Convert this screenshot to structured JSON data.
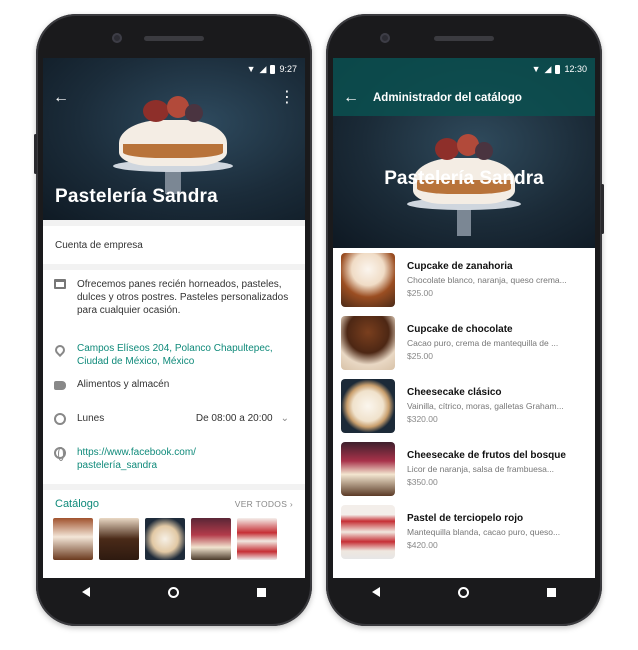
{
  "left_phone": {
    "status": {
      "time": "9:27"
    },
    "business_name": "Pastelería Sandra",
    "account_type": "Cuenta de empresa",
    "description": "Ofrecemos panes recién horneados, pasteles, dulces y otros postres. Pasteles personalizados para cualquier ocasión.",
    "address": "Campos Elíseos 204, Polanco Chapultepec, Ciudad de México, México",
    "category": "Alimentos y almacén",
    "hours": {
      "day": "Lunes",
      "time": "De 08:00 a 20:00"
    },
    "website": "https://www.facebook.com/ pastelería_sandra",
    "catalog": {
      "title": "Catálogo",
      "see_all": "VER TODOS"
    }
  },
  "right_phone": {
    "status": {
      "time": "12:30"
    },
    "appbar_title": "Administrador del catálogo",
    "business_name": "Pastelería Sandra",
    "products": [
      {
        "name": "Cupcake de zanahoria",
        "desc": "Chocolate blanco, naranja, queso crema...",
        "price": "$25.00"
      },
      {
        "name": "Cupcake de chocolate",
        "desc": "Cacao puro, crema de mantequilla de ...",
        "price": "$25.00"
      },
      {
        "name": "Cheesecake clásico",
        "desc": "Vainilla, cítrico, moras, galletas Graham...",
        "price": "$320.00"
      },
      {
        "name": "Cheesecake de frutos del bosque",
        "desc": "Licor de naranja, salsa de frambuesa...",
        "price": "$350.00"
      },
      {
        "name": "Pastel de terciopelo rojo",
        "desc": "Mantequilla blanda, cacao puro, queso...",
        "price": "$420.00"
      }
    ]
  },
  "icons": [
    "back-arrow-icon",
    "more-vert-icon",
    "store-icon",
    "location-pin-icon",
    "tag-icon",
    "clock-icon",
    "globe-icon",
    "chevron-down-icon",
    "chevron-right-icon",
    "nav-back-icon",
    "nav-home-icon",
    "nav-recents-icon"
  ],
  "colors": {
    "accent_teal": "#0f8a7a",
    "appbar_teal": "#0a5050"
  }
}
